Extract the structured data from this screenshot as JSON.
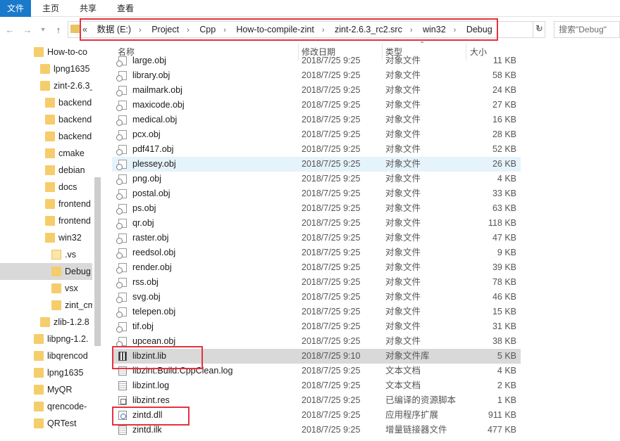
{
  "ribbon": {
    "tabs": [
      "文件",
      "主页",
      "共享",
      "查看"
    ]
  },
  "address": {
    "prefix": "«",
    "crumbs": [
      "数据 (E:)",
      "Project",
      "Cpp",
      "How-to-compile-zint",
      "zint-2.6.3_rc2.src",
      "win32",
      "Debug"
    ],
    "search_placeholder": "搜索\"Debug\""
  },
  "tree": {
    "items": [
      {
        "label": "How-to-co",
        "indent": 0,
        "open": false,
        "selected": false
      },
      {
        "label": "lpng1635",
        "indent": 1,
        "open": false,
        "selected": false
      },
      {
        "label": "zint-2.6.3_",
        "indent": 1,
        "open": false,
        "selected": false
      },
      {
        "label": "backend",
        "indent": 2,
        "open": false,
        "selected": false
      },
      {
        "label": "backend",
        "indent": 2,
        "open": false,
        "selected": false
      },
      {
        "label": "backend",
        "indent": 2,
        "open": false,
        "selected": false
      },
      {
        "label": "cmake",
        "indent": 2,
        "open": false,
        "selected": false
      },
      {
        "label": "debian",
        "indent": 2,
        "open": false,
        "selected": false
      },
      {
        "label": "docs",
        "indent": 2,
        "open": false,
        "selected": false
      },
      {
        "label": "frontend",
        "indent": 2,
        "open": false,
        "selected": false
      },
      {
        "label": "frontend",
        "indent": 2,
        "open": false,
        "selected": false
      },
      {
        "label": "win32",
        "indent": 2,
        "open": false,
        "selected": false
      },
      {
        "label": ".vs",
        "indent": 3,
        "open": true,
        "selected": false
      },
      {
        "label": "Debug",
        "indent": 3,
        "open": false,
        "selected": true
      },
      {
        "label": "vsx",
        "indent": 3,
        "open": false,
        "selected": false
      },
      {
        "label": "zint_cm",
        "indent": 3,
        "open": false,
        "selected": false
      },
      {
        "label": "zlib-1.2.8",
        "indent": 1,
        "open": false,
        "selected": false
      },
      {
        "label": "libpng-1.2.",
        "indent": 0,
        "open": false,
        "selected": false
      },
      {
        "label": "libqrencod",
        "indent": 0,
        "open": false,
        "selected": false
      },
      {
        "label": "lpng1635",
        "indent": 0,
        "open": false,
        "selected": false
      },
      {
        "label": "MyQR",
        "indent": 0,
        "open": false,
        "selected": false
      },
      {
        "label": "qrencode-",
        "indent": 0,
        "open": false,
        "selected": false
      },
      {
        "label": "QRTest",
        "indent": 0,
        "open": false,
        "selected": false
      }
    ]
  },
  "columns": {
    "name": "名称",
    "date": "修改日期",
    "type": "类型",
    "size": "大小"
  },
  "files": [
    {
      "name": "large.obj",
      "date": "2018/7/25 9:25",
      "type": "对象文件",
      "size": "11 KB",
      "icon": "obj"
    },
    {
      "name": "library.obj",
      "date": "2018/7/25 9:25",
      "type": "对象文件",
      "size": "58 KB",
      "icon": "obj"
    },
    {
      "name": "mailmark.obj",
      "date": "2018/7/25 9:25",
      "type": "对象文件",
      "size": "24 KB",
      "icon": "obj"
    },
    {
      "name": "maxicode.obj",
      "date": "2018/7/25 9:25",
      "type": "对象文件",
      "size": "27 KB",
      "icon": "obj"
    },
    {
      "name": "medical.obj",
      "date": "2018/7/25 9:25",
      "type": "对象文件",
      "size": "16 KB",
      "icon": "obj"
    },
    {
      "name": "pcx.obj",
      "date": "2018/7/25 9:25",
      "type": "对象文件",
      "size": "28 KB",
      "icon": "obj"
    },
    {
      "name": "pdf417.obj",
      "date": "2018/7/25 9:25",
      "type": "对象文件",
      "size": "52 KB",
      "icon": "obj"
    },
    {
      "name": "plessey.obj",
      "date": "2018/7/25 9:25",
      "type": "对象文件",
      "size": "26 KB",
      "icon": "obj"
    },
    {
      "name": "png.obj",
      "date": "2018/7/25 9:25",
      "type": "对象文件",
      "size": "4 KB",
      "icon": "obj"
    },
    {
      "name": "postal.obj",
      "date": "2018/7/25 9:25",
      "type": "对象文件",
      "size": "33 KB",
      "icon": "obj"
    },
    {
      "name": "ps.obj",
      "date": "2018/7/25 9:25",
      "type": "对象文件",
      "size": "63 KB",
      "icon": "obj"
    },
    {
      "name": "qr.obj",
      "date": "2018/7/25 9:25",
      "type": "对象文件",
      "size": "118 KB",
      "icon": "obj"
    },
    {
      "name": "raster.obj",
      "date": "2018/7/25 9:25",
      "type": "对象文件",
      "size": "47 KB",
      "icon": "obj"
    },
    {
      "name": "reedsol.obj",
      "date": "2018/7/25 9:25",
      "type": "对象文件",
      "size": "9 KB",
      "icon": "obj"
    },
    {
      "name": "render.obj",
      "date": "2018/7/25 9:25",
      "type": "对象文件",
      "size": "39 KB",
      "icon": "obj"
    },
    {
      "name": "rss.obj",
      "date": "2018/7/25 9:25",
      "type": "对象文件",
      "size": "78 KB",
      "icon": "obj"
    },
    {
      "name": "svg.obj",
      "date": "2018/7/25 9:25",
      "type": "对象文件",
      "size": "46 KB",
      "icon": "obj"
    },
    {
      "name": "telepen.obj",
      "date": "2018/7/25 9:25",
      "type": "对象文件",
      "size": "15 KB",
      "icon": "obj"
    },
    {
      "name": "tif.obj",
      "date": "2018/7/25 9:25",
      "type": "对象文件",
      "size": "31 KB",
      "icon": "obj"
    },
    {
      "name": "upcean.obj",
      "date": "2018/7/25 9:25",
      "type": "对象文件",
      "size": "38 KB",
      "icon": "obj"
    },
    {
      "name": "libzint.lib",
      "date": "2018/7/25 9:10",
      "type": "对象文件库",
      "size": "5 KB",
      "icon": "lib"
    },
    {
      "name": "libzint.Build.CppClean.log",
      "date": "2018/7/25 9:25",
      "type": "文本文档",
      "size": "4 KB",
      "icon": "txt"
    },
    {
      "name": "libzint.log",
      "date": "2018/7/25 9:25",
      "type": "文本文档",
      "size": "2 KB",
      "icon": "txt"
    },
    {
      "name": "libzint.res",
      "date": "2018/7/25 9:25",
      "type": "已编译的资源脚本",
      "size": "1 KB",
      "icon": "res"
    },
    {
      "name": "zintd.dll",
      "date": "2018/7/25 9:25",
      "type": "应用程序扩展",
      "size": "911 KB",
      "icon": "dll"
    },
    {
      "name": "zintd.ilk",
      "date": "2018/7/25 9:25",
      "type": "增量链接器文件",
      "size": "477 KB",
      "icon": "txt"
    }
  ],
  "state": {
    "hover_row": 7,
    "selected_row": 20
  },
  "colors": {
    "accent": "#1979ca",
    "highlight_red": "#e5323e",
    "selection_gray": "#d9d9d9",
    "hover_blue": "#e5f3fb",
    "folder_yellow": "#f5cd6a"
  }
}
